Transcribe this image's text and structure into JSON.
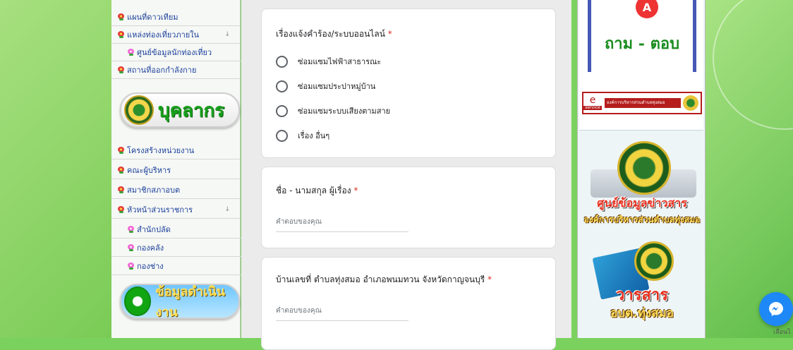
{
  "sidebar": {
    "items_top": [
      {
        "label": "แผนที่ดาวเทียม",
        "sub": false,
        "expand": false
      },
      {
        "label": "แหล่งท่องเที่ยวภายใน",
        "sub": false,
        "expand": true
      },
      {
        "label": "ศูนย์ข้อมูลนักท่องเที่ยว",
        "sub": true,
        "expand": false
      },
      {
        "label": "สถานที่ออกกำลังกาย",
        "sub": false,
        "expand": false
      }
    ],
    "banner_personnel": "บุคลากร",
    "items_mid": [
      {
        "label": "โครงสร้างหน่วยงาน",
        "sub": false,
        "expand": false
      },
      {
        "label": "คณะผู้บริหาร",
        "sub": false,
        "expand": false
      },
      {
        "label": "สมาชิกสภาอบต",
        "sub": false,
        "expand": false
      },
      {
        "label": "หัวหน้าส่วนราชการ",
        "sub": false,
        "expand": true
      },
      {
        "label": "สำนักปลัด",
        "sub": true,
        "expand": false
      },
      {
        "label": "กองคลัง",
        "sub": true,
        "expand": false
      },
      {
        "label": "กองช่าง",
        "sub": true,
        "expand": false
      }
    ],
    "banner_operations": "ข้อมูลดำเนินงาน",
    "expand_arrow": "↓"
  },
  "form": {
    "q1": {
      "title": "เรื่องแจ้งคำร้อง/ระบบออนไลน์",
      "required_mark": "*",
      "options": [
        "ซ่อมแซมไฟฟ้าสาธารณะ",
        "ซ่อมแซมประปาหมู่บ้าน",
        "ซ่อมแซมระบบเสียงตามสาย",
        "เรื่อง อื่นๆ"
      ]
    },
    "q2": {
      "title": "ชื่อ - นามสกุล ผู้เรื่อง",
      "required_mark": "*",
      "placeholder": "คำตอบของคุณ"
    },
    "q3": {
      "title": "บ้านเลขที่ ตำบลทุ่งสมอ อำเภอพนมทวน จังหวัดกาญจนบุรี",
      "required_mark": "*",
      "placeholder": "คำตอบของคุณ"
    }
  },
  "right": {
    "qa_text": "ถาม - ตอบ",
    "qa_badge": "A",
    "eservice_e": "e",
    "eservice_small": "service",
    "eservice_bar": "องค์การบริหารส่วนตำบลทุ่งสมอ",
    "news_title": "ศูนย์ข้อมูลข่าวสาร",
    "news_sub": "องค์การบริหารส่วนตำบลทุ่งสมอ",
    "journal_title": "วารสาร",
    "journal_sub": "อบต.ทุ่งสมอ"
  },
  "chat": {
    "label": "เลื่อนไ"
  },
  "colors": {
    "accent": "#1e88f6",
    "required": "#d93025",
    "menu_text": "#1b3f9b"
  }
}
